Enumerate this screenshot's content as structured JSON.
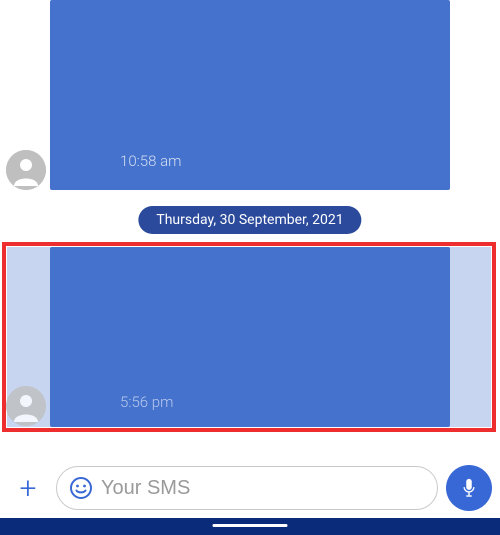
{
  "messages": {
    "first": {
      "timestamp": "10:58 am"
    },
    "second": {
      "timestamp": "5:56 pm"
    }
  },
  "date_separator": "Thursday, 30 September, 2021",
  "composer": {
    "placeholder": "Your SMS"
  }
}
